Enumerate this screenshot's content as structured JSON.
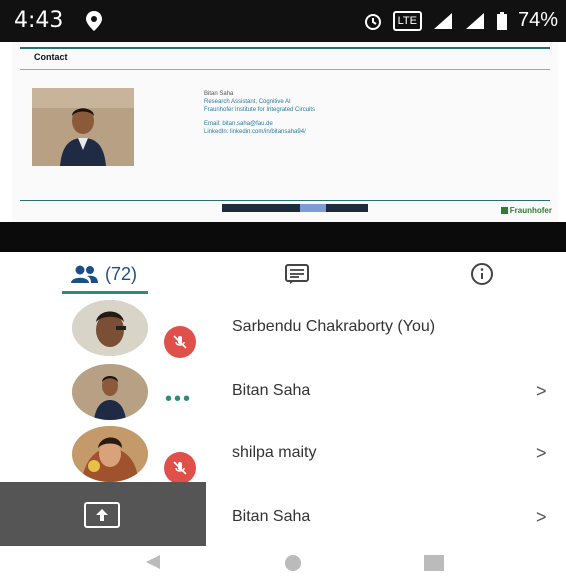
{
  "status_bar": {
    "time": "4:43",
    "network": "LTE",
    "battery": "74%"
  },
  "slide": {
    "heading": "Contact",
    "presenter_name": "Bitan Saha",
    "presenter_role": "Research Assistant, Cognitive AI",
    "presenter_org": "Fraunhofer Institute for Integrated Circuits",
    "presenter_email": "Email: bitan.saha@fau.de",
    "presenter_linkedin": "LinkedIn: linkedin.com/in/bitansaha94/",
    "logo_text": "Fraunhofer",
    "progress": 0.65
  },
  "tabs": {
    "participants_count": "(72)"
  },
  "participants": [
    {
      "name": "Sarbendu Chakraborty (You)",
      "status": "muted",
      "has_chevron": false
    },
    {
      "name": "Bitan Saha",
      "status": "speaking",
      "has_chevron": true,
      "chevron": ">"
    },
    {
      "name": "shilpa maity",
      "status": "muted",
      "has_chevron": true,
      "chevron": ">"
    },
    {
      "name": "Bitan Saha",
      "status": "muted",
      "has_chevron": true,
      "chevron": ">"
    }
  ],
  "colors": {
    "accent": "#2e8b7a",
    "tab_text": "#1b4f8a",
    "mute_badge": "#e0504a"
  },
  "icons": {
    "participants_tab": "people-icon",
    "chat_tab": "chat-icon",
    "info_tab": "info-icon",
    "mute": "mic-off-icon",
    "share": "share-screen-icon"
  }
}
